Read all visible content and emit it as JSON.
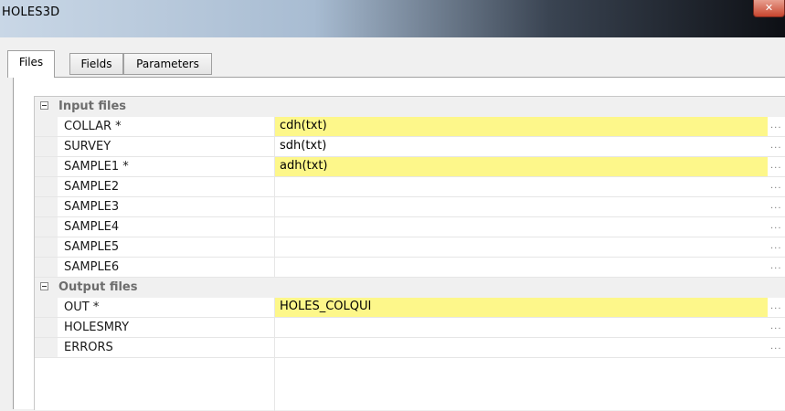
{
  "window": {
    "title": "HOLES3D"
  },
  "tabs": [
    {
      "label": "Files"
    },
    {
      "label": "Fields"
    },
    {
      "label": "Parameters"
    }
  ],
  "grid": {
    "ellipsis": "...",
    "input_category": "Input files",
    "output_category": "Output files",
    "input_rows": [
      {
        "name": "COLLAR *",
        "value": "cdh(txt)"
      },
      {
        "name": "SURVEY",
        "value": "sdh(txt)"
      },
      {
        "name": "SAMPLE1 *",
        "value": "adh(txt)"
      },
      {
        "name": "SAMPLE2",
        "value": ""
      },
      {
        "name": "SAMPLE3",
        "value": ""
      },
      {
        "name": "SAMPLE4",
        "value": ""
      },
      {
        "name": "SAMPLE5",
        "value": ""
      },
      {
        "name": "SAMPLE6",
        "value": ""
      }
    ],
    "output_rows": [
      {
        "name": "OUT *",
        "value": "HOLES_COLQUI"
      },
      {
        "name": "HOLESMRY",
        "value": ""
      },
      {
        "name": "ERRORS",
        "value": ""
      }
    ]
  },
  "colors": {
    "required_field": "#fdf78a",
    "category_bg": "#f0f0f0",
    "close_button": "#c8452e"
  }
}
